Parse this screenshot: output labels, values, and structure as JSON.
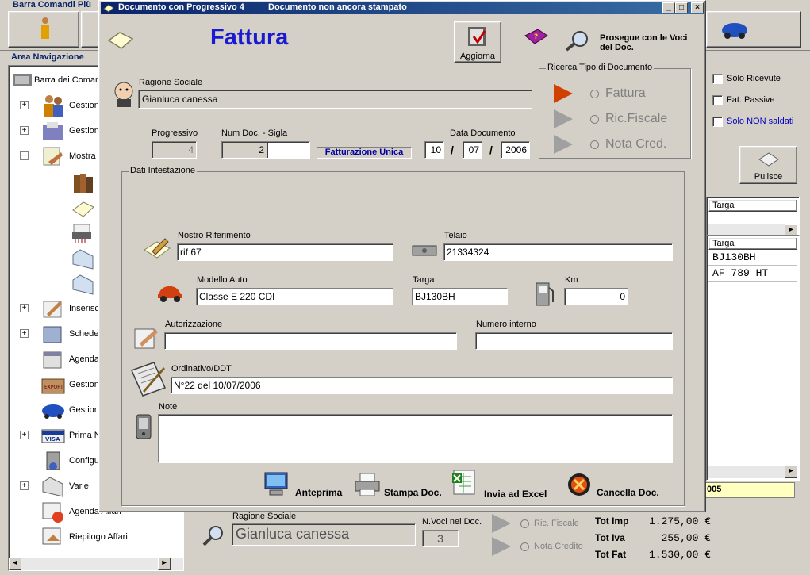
{
  "main_window": {
    "toolbar_title": "Barra Comandi Più",
    "nav_title": "Area Navigazione",
    "nav_items": [
      {
        "label": "Barra dei Comandi"
      },
      {
        "label": "Gestion"
      },
      {
        "label": "Gestion"
      },
      {
        "label": "Mostra"
      },
      {
        "label": "Inserisc"
      },
      {
        "label": "Schede"
      },
      {
        "label": "Agenda"
      },
      {
        "label": "Gestion"
      },
      {
        "label": "Gestion"
      },
      {
        "label": "Prima N"
      },
      {
        "label": "Configu"
      },
      {
        "label": "Varie"
      },
      {
        "label": "Agenda Affari"
      },
      {
        "label": "Riepilogo Affari"
      }
    ],
    "filters": {
      "solo_ricevute": "Solo Ricevute",
      "fat_passive": "Fat. Passive",
      "solo_non_saldati": "Solo NON saldati"
    },
    "pulisce_label": "Pulisce",
    "grid_top": {
      "header": "Targa"
    },
    "grid_bottom": {
      "header": "Targa",
      "rows": [
        "BJ130BH",
        "AF 789 HT"
      ]
    },
    "status_fragment": "005",
    "bottom": {
      "ragione_sociale_label": "Ragione Sociale",
      "ragione_sociale_value": "Gianluca canessa",
      "n_voci_label": "N.Voci nel Doc.",
      "n_voci_value": "3",
      "ric_fiscale": "Ric. Fiscale",
      "nota_credito": "Nota Credito",
      "totals": [
        {
          "label": "Tot Imp",
          "value": "1.275,00 €"
        },
        {
          "label": "Tot Iva",
          "value": "255,00 €"
        },
        {
          "label": "Tot Fat",
          "value": "1.530,00 €"
        }
      ]
    }
  },
  "dialog": {
    "title": "Documento con Progressivo 4",
    "status": "Documento non ancora stampato",
    "heading": "Fattura",
    "aggiorna": "Aggiorna",
    "prosegue": "Prosegue con le Voci del Doc.",
    "ragione_sociale": {
      "label": "Ragione Sociale",
      "value": "Gianluca canessa"
    },
    "progressivo": {
      "label": "Progressivo",
      "value": "4"
    },
    "num_doc": {
      "label": "Num Doc. - Sigla",
      "value": "2",
      "sigla": ""
    },
    "fatturazione_unica": "Fatturazione Unica",
    "data_documento": {
      "label": "Data Documento",
      "day": "10",
      "month": "07",
      "year": "2006",
      "sep": "/"
    },
    "ricerca": {
      "title": "Ricerca Tipo di Documento",
      "options": [
        "Fattura",
        "Ric.Fiscale",
        "Nota Cred."
      ]
    },
    "intestazione": {
      "title": "Dati Intestazione",
      "nostro_riferimento": {
        "label": "Nostro Riferimento",
        "value": "rif 67"
      },
      "telaio": {
        "label": "Telaio",
        "value": "21334324"
      },
      "modello_auto": {
        "label": "Modello Auto",
        "value": "Classe E 220 CDI"
      },
      "targa": {
        "label": "Targa",
        "value": "BJ130BH"
      },
      "km": {
        "label": "Km",
        "value": "0"
      },
      "autorizzazione": {
        "label": "Autorizzazione",
        "value": ""
      },
      "numero_interno": {
        "label": "Numero interno",
        "value": ""
      },
      "ordinativo": {
        "label": "Ordinativo/DDT",
        "value": "N°22 del 10/07/2006"
      },
      "note": {
        "label": "Note",
        "value": ""
      }
    },
    "actions": {
      "anteprima": "Anteprima",
      "stampa": "Stampa Doc.",
      "excel": "Invia ad Excel",
      "cancella": "Cancella Doc."
    }
  }
}
